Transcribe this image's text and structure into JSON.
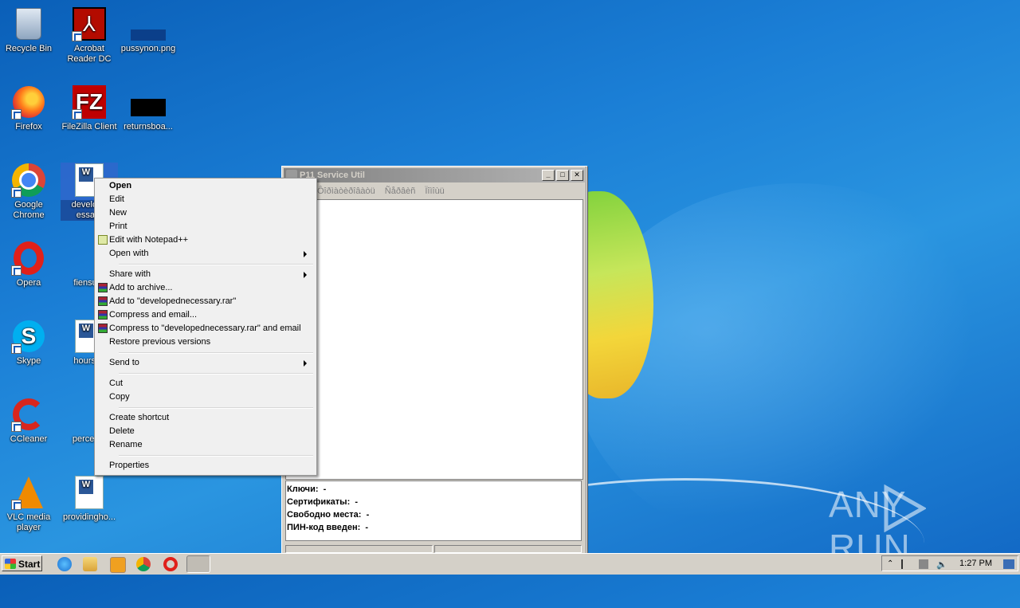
{
  "desktop_icons": [
    {
      "label": "Recycle Bin"
    },
    {
      "label": "Acrobat Reader DC"
    },
    {
      "label": "pussynon.png"
    },
    {
      "label": "Firefox"
    },
    {
      "label": "FileZilla Client"
    },
    {
      "label": "returnsboa..."
    },
    {
      "label": "Google Chrome"
    },
    {
      "label": "develope essary"
    },
    {
      "label": "Opera"
    },
    {
      "label": "fiensure"
    },
    {
      "label": "Skype"
    },
    {
      "label": "hoursus"
    },
    {
      "label": "CCleaner"
    },
    {
      "label": "percents"
    },
    {
      "label": "VLC media player"
    },
    {
      "label": "providingho..."
    }
  ],
  "window": {
    "title": "P11 Service Util",
    "menu": [
      "Ôîðìàòèðîâàòü",
      "Ñåðâèñ",
      "Ïîìîùü"
    ],
    "info": [
      {
        "label": "Ключи:",
        "value": "-"
      },
      {
        "label": "Сертификаты:",
        "value": "-"
      },
      {
        "label": "Свободно места:",
        "value": "-"
      },
      {
        "label": "ПИН-код введен:",
        "value": "-"
      }
    ],
    "buttons": {
      "minimize": "_",
      "maximize": "□",
      "close": "✕"
    }
  },
  "context_menu": {
    "items": [
      {
        "label": "Open"
      },
      {
        "label": "Edit"
      },
      {
        "label": "New"
      },
      {
        "label": "Print"
      },
      {
        "label": "Edit with Notepad++"
      },
      {
        "label": "Open with"
      },
      {
        "label": "Share with"
      },
      {
        "label": "Add to archive..."
      },
      {
        "label": "Add to \"developednecessary.rar\""
      },
      {
        "label": "Compress and email..."
      },
      {
        "label": "Compress to \"developednecessary.rar\" and email"
      },
      {
        "label": "Restore previous versions"
      },
      {
        "label": "Send to"
      },
      {
        "label": "Cut"
      },
      {
        "label": "Copy"
      },
      {
        "label": "Create shortcut"
      },
      {
        "label": "Delete"
      },
      {
        "label": "Rename"
      },
      {
        "label": "Properties"
      }
    ]
  },
  "taskbar": {
    "start_label": "Start",
    "clock": "1:27 PM"
  },
  "watermark": {
    "left": "ANY",
    "right": "RUN"
  }
}
